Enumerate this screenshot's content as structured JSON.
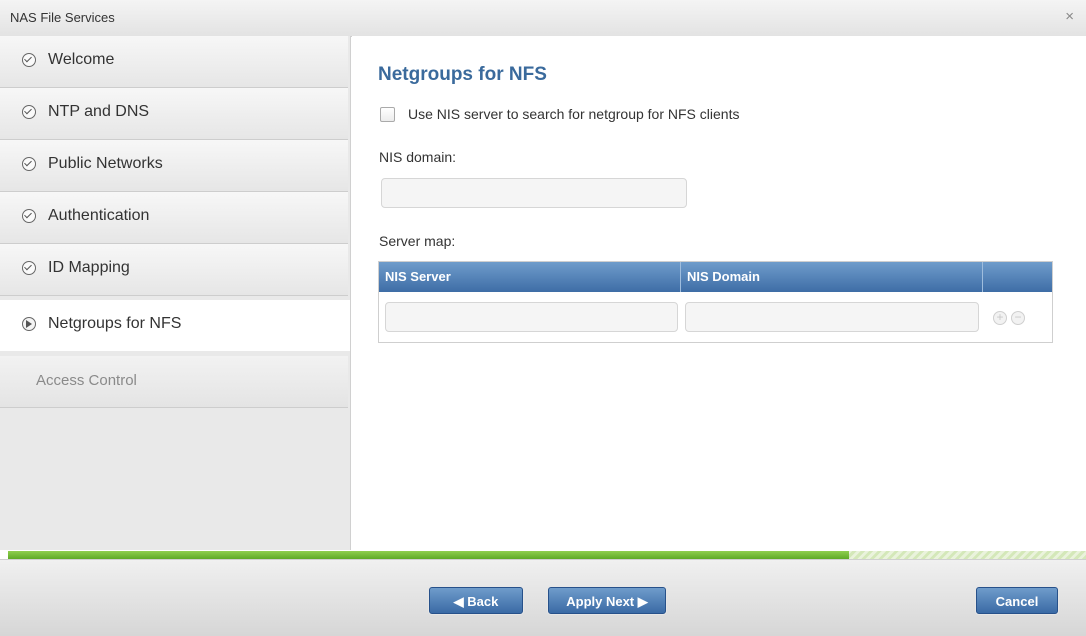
{
  "window": {
    "title": "NAS File Services",
    "close_glyph": "×"
  },
  "sidebar": {
    "items": [
      {
        "label": "Welcome",
        "state": "done"
      },
      {
        "label": "NTP and DNS",
        "state": "done"
      },
      {
        "label": "Public Networks",
        "state": "done"
      },
      {
        "label": "Authentication",
        "state": "done"
      },
      {
        "label": "ID Mapping",
        "state": "done"
      },
      {
        "label": "Netgroups for NFS",
        "state": "current"
      },
      {
        "label": "Access Control",
        "state": "disabled"
      }
    ]
  },
  "main": {
    "heading": "Netgroups for NFS",
    "use_nis_label": "Use NIS server to search for netgroup for NFS clients",
    "use_nis_checked": false,
    "nis_domain_label": "NIS domain:",
    "nis_domain_value": "",
    "server_map_label": "Server map:",
    "table": {
      "columns": [
        "NIS Server",
        "NIS Domain"
      ],
      "rows": [
        {
          "nis_server": "",
          "nis_domain": ""
        }
      ]
    }
  },
  "progress": {
    "fraction": 0.78
  },
  "footer": {
    "back_label": "◀ Back",
    "next_label": "Apply Next ▶",
    "cancel_label": "Cancel"
  },
  "colors": {
    "accent": "#3a6a9c",
    "button": "#4a78b0",
    "progress": "#6cbd30"
  }
}
